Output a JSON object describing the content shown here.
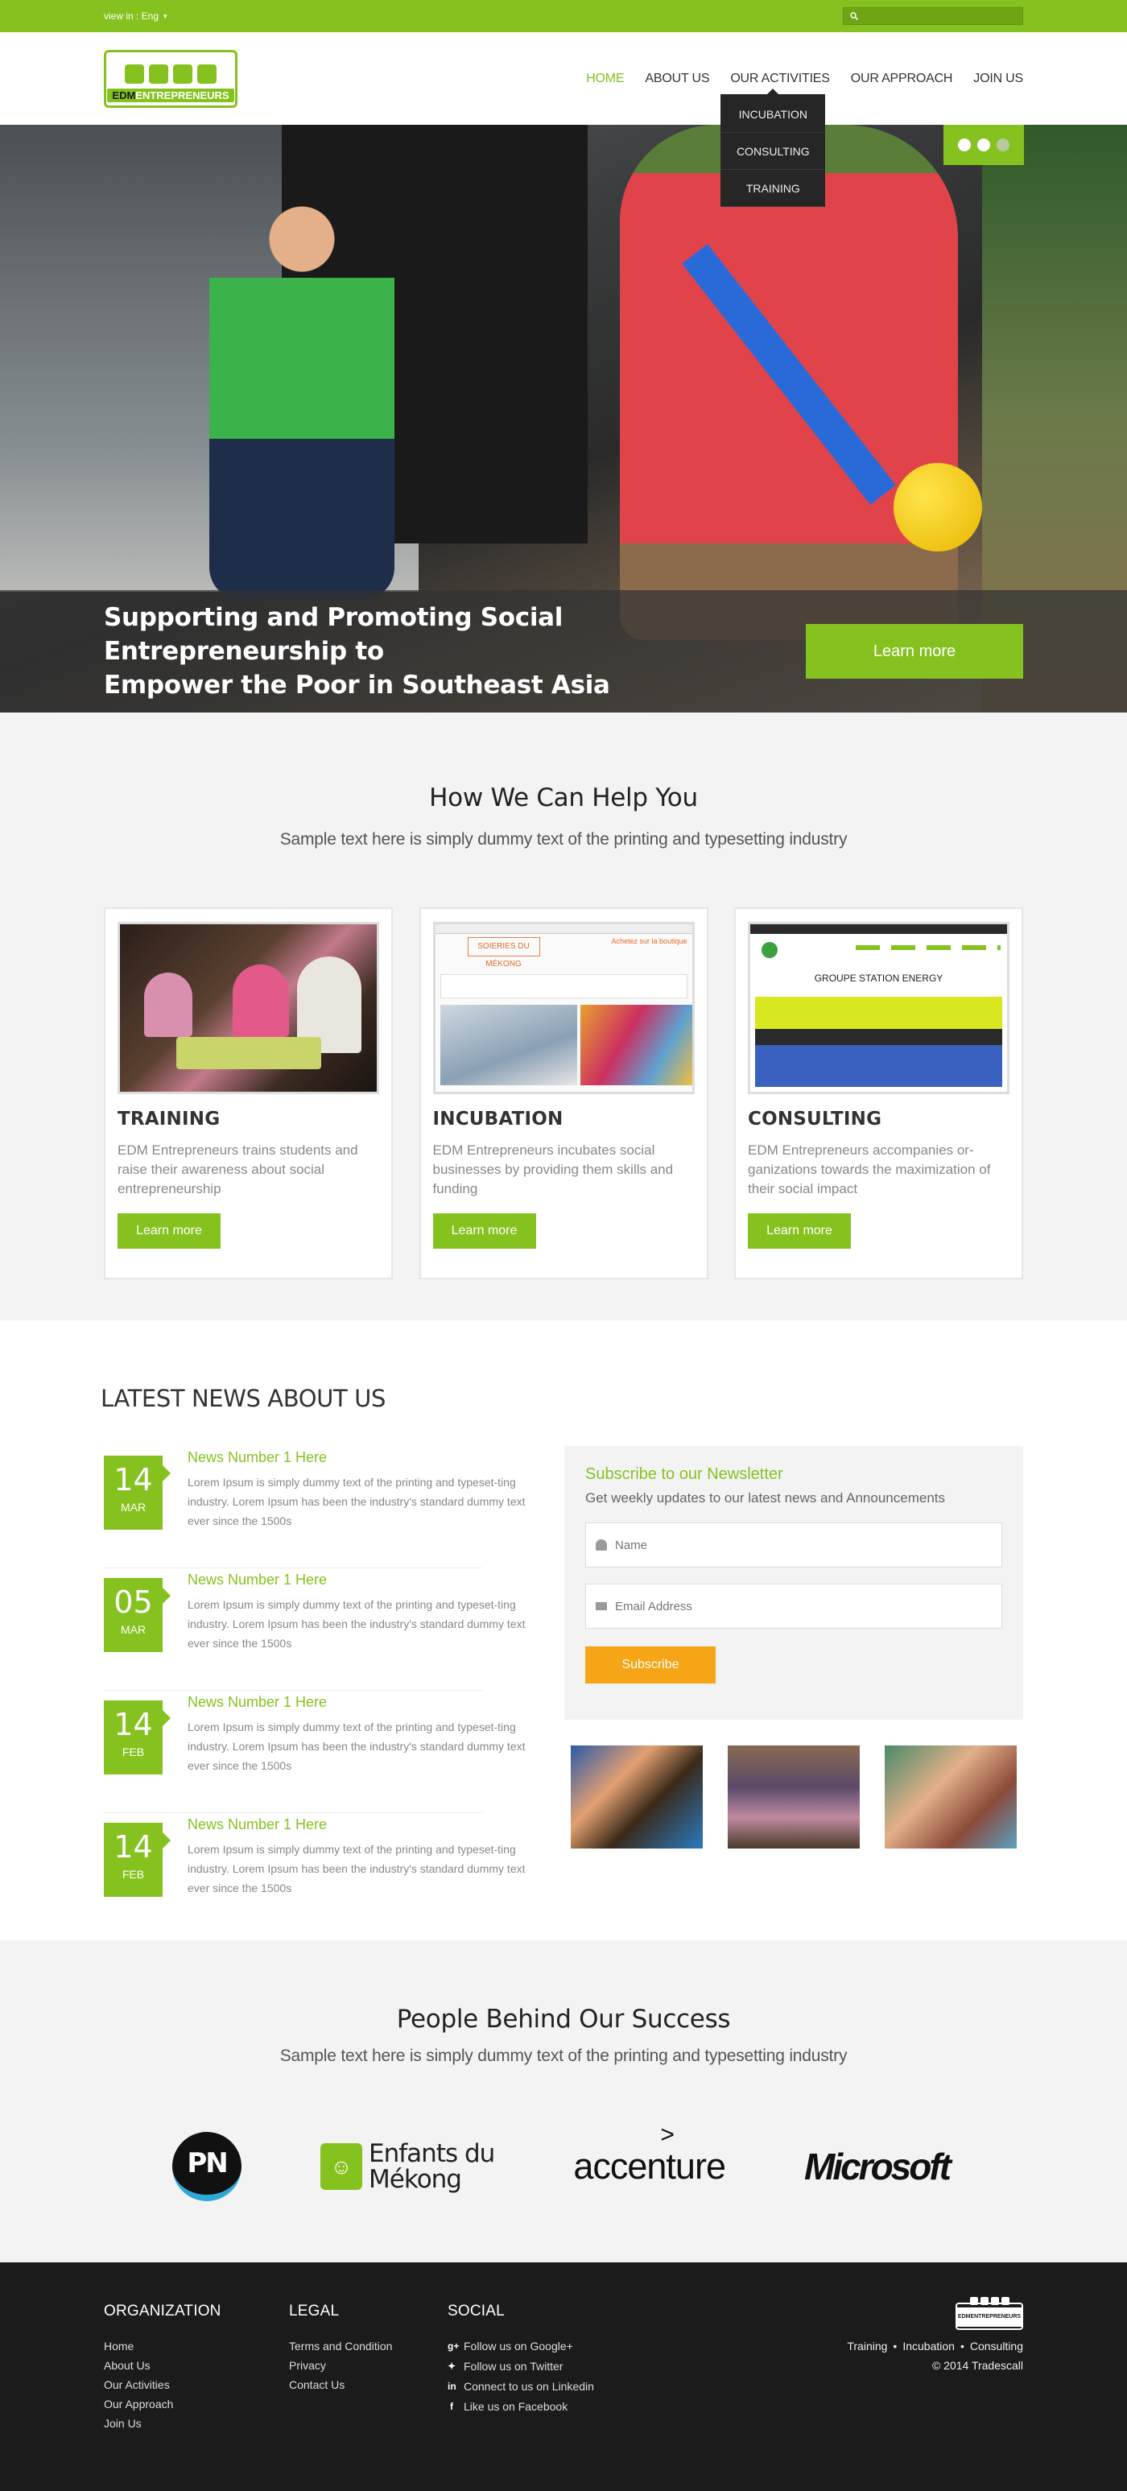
{
  "topbar": {
    "view_in": "view in : Eng",
    "search_placeholder": ""
  },
  "logo": {
    "text_a": "EDM",
    "text_b": "ENTREPRENEURS"
  },
  "nav": {
    "items": [
      "HOME",
      "ABOUT US",
      "OUR ACTIVITIES",
      "OUR APPROACH",
      "JOIN US"
    ],
    "dropdown": [
      "INCUBATION",
      "CONSULTING",
      "TRAINING"
    ]
  },
  "hero": {
    "headline_line1": "Supporting and Promoting Social Entrepreneurship to",
    "headline_line2": "Empower the Poor in Southeast Asia",
    "cta": "Learn more",
    "slide_count": 3,
    "active_slides": 2
  },
  "help": {
    "title": "How We Can Help You",
    "subtitle": "Sample text here is simply dummy text of the printing and typesetting industry",
    "cards": [
      {
        "title": "TRAINING",
        "text": "EDM Entrepreneurs trains students and raise their awareness about social entrepreneurship",
        "button": "Learn more"
      },
      {
        "title": "INCUBATION",
        "text": "EDM Entrepreneurs incubates social businesses by providing them skills and funding",
        "button": "Learn more",
        "shot_logo": "SOIERIES DU MÉKONG",
        "shot_header": "Achetez sur la boutique"
      },
      {
        "title": "CONSULTING",
        "text": "EDM Entrepreneurs accompanies or-ganizations towards the maximization of their social impact",
        "button": "Learn more",
        "shot_title": "GROUPE STATION ENERGY"
      }
    ]
  },
  "news": {
    "title": "LATEST NEWS ABOUT US",
    "items": [
      {
        "day": "14",
        "month": "MAR",
        "title": "News Number 1 Here",
        "text": "Lorem Ipsum is simply dummy text of the printing and typeset-ting industry. Lorem Ipsum has been the industry's standard dummy text ever since the 1500s"
      },
      {
        "day": "05",
        "month": "MAR",
        "title": "News Number 1 Here",
        "text": "Lorem Ipsum is simply dummy text of the printing and typeset-ting industry. Lorem Ipsum has been the industry's standard dummy text ever since the 1500s"
      },
      {
        "day": "14",
        "month": "FEB",
        "title": "News Number 1 Here",
        "text": "Lorem Ipsum is simply dummy text of the printing and typeset-ting industry. Lorem Ipsum has been the industry's standard dummy text ever since the 1500s"
      },
      {
        "day": "14",
        "month": "FEB",
        "title": "News Number 1 Here",
        "text": "Lorem Ipsum is simply dummy text of the printing and typeset-ting industry. Lorem Ipsum has been the industry's standard dummy text ever since the 1500s"
      }
    ]
  },
  "newsletter": {
    "title": "Subscribe to our Newsletter",
    "subtitle": "Get weekly updates to our latest news and Announcements",
    "name_placeholder": "Name",
    "email_placeholder": "Email Address",
    "button": "Subscribe"
  },
  "partners": {
    "title": "People Behind Our Success",
    "subtitle": "Sample text here is simply dummy text of the printing and typesetting industry",
    "logos": {
      "pn": "PN",
      "edm_line1": "Enfants du",
      "edm_line2": "Mékong",
      "accenture": "accenture",
      "microsoft": "Microsoft"
    }
  },
  "footer": {
    "organization": {
      "title": "ORGANIZATION",
      "links": [
        "Home",
        "About Us",
        "Our Activities",
        "Our Approach",
        "Join Us"
      ]
    },
    "legal": {
      "title": "LEGAL",
      "links": [
        "Terms and Condition",
        "Privacy",
        "Contact Us"
      ]
    },
    "social": {
      "title": "SOCIAL",
      "links": [
        "Follow us on Google+",
        "Follow us on Twitter",
        "Connect to us on Linkedin",
        "Like us on Facebook"
      ]
    },
    "right_links": [
      "Training",
      "Incubation",
      "Consulting"
    ],
    "copyright": "© 2014  Tradescall"
  },
  "colors": {
    "accent": "#86c21f",
    "orange": "#f5a515",
    "footer_bg": "#1b1b1b"
  }
}
